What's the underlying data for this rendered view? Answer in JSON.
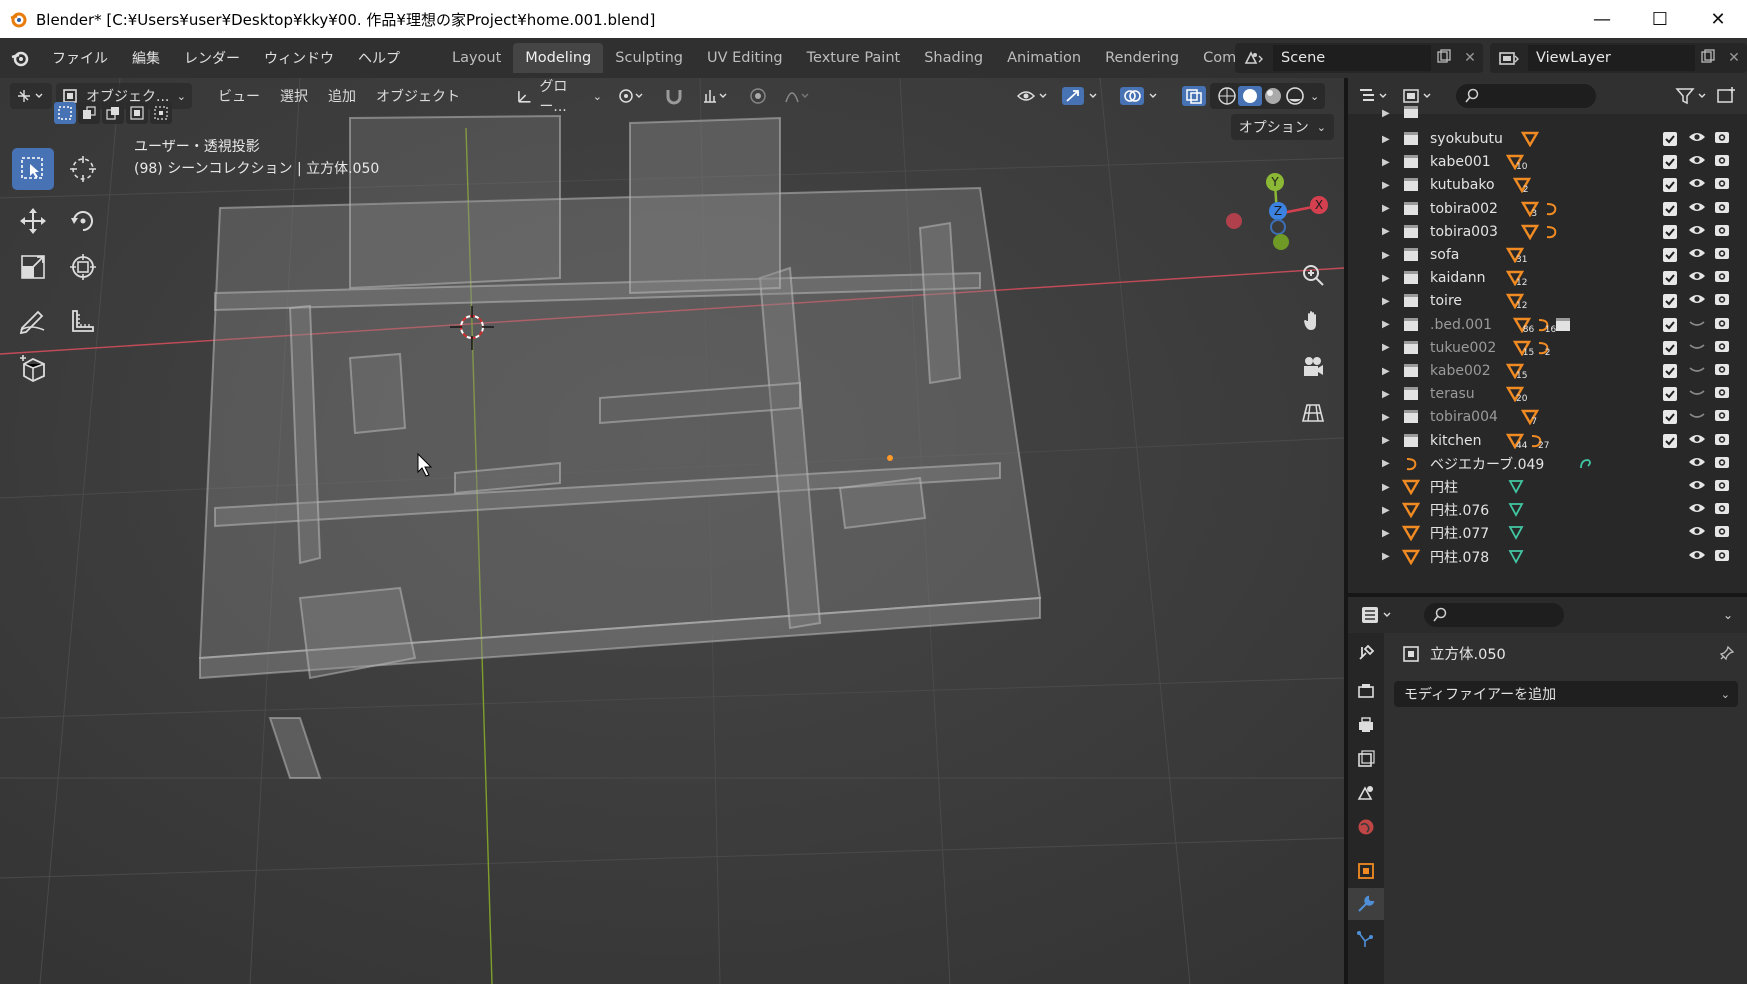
{
  "window": {
    "title": "Blender* [C:¥Users¥user¥Desktop¥kky¥00. 作品¥理想の家Project¥home.001.blend]",
    "minimize": "—",
    "maximize": "☐",
    "close": "✕"
  },
  "menubar": {
    "items": [
      "ファイル",
      "編集",
      "レンダー",
      "ウィンドウ",
      "ヘルプ"
    ],
    "workspaces": [
      "Layout",
      "Modeling",
      "Sculpting",
      "UV Editing",
      "Texture Paint",
      "Shading",
      "Animation",
      "Rendering",
      "Compositing"
    ],
    "active_workspace": "Modeling",
    "scene": "Scene",
    "view_layer": "ViewLayer"
  },
  "viewport": {
    "mode": "オブジェク...",
    "menus": [
      "ビュー",
      "選択",
      "追加",
      "オブジェクト"
    ],
    "transform_orientation": "グロー...",
    "view_name": "ユーザー・透視投影",
    "collection_info": "(98) シーンコレクション | 立方体.050",
    "options": "オプション",
    "gizmo_axes": {
      "x": "X",
      "y": "Y",
      "z": "Z"
    },
    "colors": {
      "x_axis": "#d4404f",
      "y_axis": "#8bb935",
      "z_axis": "#3c82e0",
      "select_active": "#4772b3"
    }
  },
  "outliner": {
    "rows": [
      {
        "name": "syokubutu",
        "dim": false,
        "badges": [
          {
            "icon": "mesh-icon",
            "num": ""
          }
        ],
        "checked": true,
        "visible": true
      },
      {
        "name": "kabe001",
        "dim": false,
        "badges": [
          {
            "icon": "mesh-icon",
            "num": "10"
          }
        ],
        "checked": true,
        "visible": true
      },
      {
        "name": "kutubako",
        "dim": false,
        "badges": [
          {
            "icon": "mesh-icon",
            "num": "2"
          }
        ],
        "checked": true,
        "visible": true
      },
      {
        "name": "tobira002",
        "dim": false,
        "badges": [
          {
            "icon": "mesh-icon",
            "num": "3"
          },
          {
            "icon": "curve-icon",
            "num": ""
          }
        ],
        "checked": true,
        "visible": true
      },
      {
        "name": "tobira003",
        "dim": false,
        "badges": [
          {
            "icon": "mesh-icon",
            "num": ""
          },
          {
            "icon": "curve-icon",
            "num": ""
          }
        ],
        "checked": true,
        "visible": true
      },
      {
        "name": "sofa",
        "dim": false,
        "badges": [
          {
            "icon": "mesh-icon",
            "num": "31"
          }
        ],
        "checked": true,
        "visible": true
      },
      {
        "name": "kaidann",
        "dim": false,
        "badges": [
          {
            "icon": "mesh-icon",
            "num": "12"
          }
        ],
        "checked": true,
        "visible": true
      },
      {
        "name": "toire",
        "dim": false,
        "badges": [
          {
            "icon": "mesh-icon",
            "num": "12"
          }
        ],
        "checked": true,
        "visible": true
      },
      {
        "name": ".bed.001",
        "dim": true,
        "badges": [
          {
            "icon": "mesh-icon",
            "num": "86"
          },
          {
            "icon": "curve-icon",
            "num": "16"
          },
          {
            "icon": "collection-icon",
            "num": ""
          }
        ],
        "checked": true,
        "visible": false
      },
      {
        "name": "tukue002",
        "dim": true,
        "badges": [
          {
            "icon": "mesh-icon",
            "num": "15"
          },
          {
            "icon": "curve-icon",
            "num": "2"
          }
        ],
        "checked": true,
        "visible": false
      },
      {
        "name": "kabe002",
        "dim": true,
        "badges": [
          {
            "icon": "mesh-icon",
            "num": "15"
          }
        ],
        "checked": true,
        "visible": false
      },
      {
        "name": "terasu",
        "dim": true,
        "badges": [
          {
            "icon": "mesh-icon",
            "num": "20"
          }
        ],
        "checked": true,
        "visible": false
      },
      {
        "name": "tobira004",
        "dim": true,
        "badges": [
          {
            "icon": "mesh-icon",
            "num": "7"
          }
        ],
        "checked": true,
        "visible": false
      },
      {
        "name": "kitchen",
        "dim": false,
        "badges": [
          {
            "icon": "mesh-icon",
            "num": "44"
          },
          {
            "icon": "curve-icon",
            "num": "27"
          }
        ],
        "checked": true,
        "visible": true
      },
      {
        "name": "ベジエカーブ.049",
        "dim": false,
        "type": "curve",
        "badges": [],
        "checked": false,
        "visible": true
      },
      {
        "name": "円柱",
        "dim": false,
        "type": "mesh",
        "badges": [],
        "checked": false,
        "visible": true
      },
      {
        "name": "円柱.076",
        "dim": false,
        "type": "mesh",
        "badges": [],
        "checked": false,
        "visible": true
      },
      {
        "name": "円柱.077",
        "dim": false,
        "type": "mesh",
        "badges": [],
        "checked": false,
        "visible": true
      },
      {
        "name": "円柱.078",
        "dim": false,
        "type": "mesh",
        "badges": [],
        "checked": false,
        "visible": true
      }
    ]
  },
  "properties": {
    "object_name": "立方体.050",
    "add_modifier": "モディファイアーを追加"
  }
}
